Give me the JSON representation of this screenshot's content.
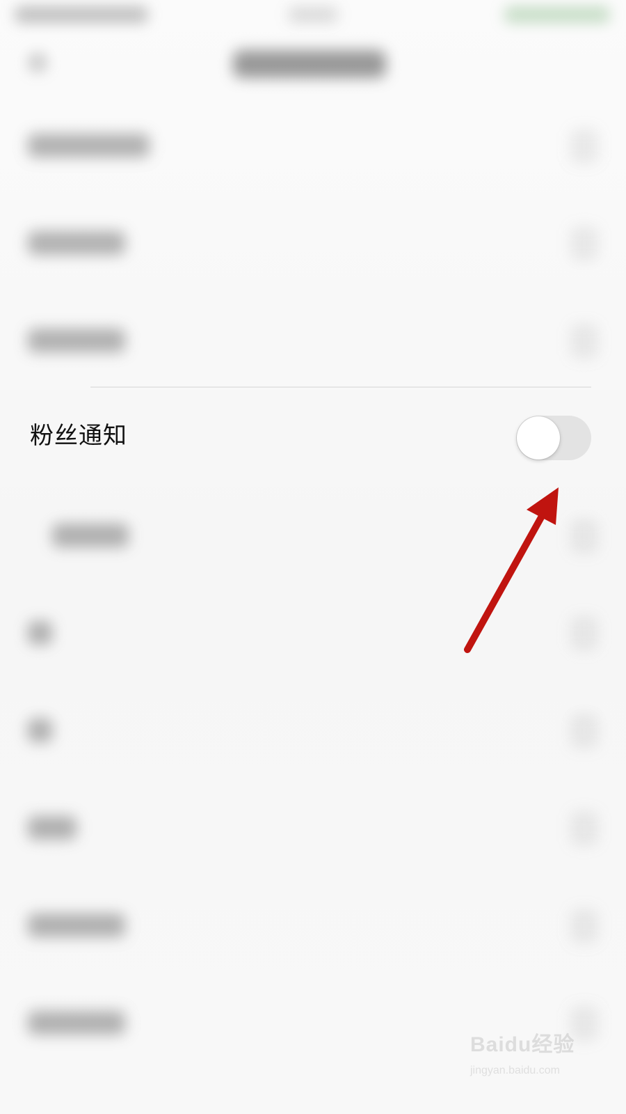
{
  "settings": {
    "fan_notification": {
      "label": "粉丝通知",
      "enabled": false
    }
  },
  "colors": {
    "background": "#f5f5f5",
    "focus_row_background": "#f7f7f7",
    "toggle_track_off": "#e3e3e3",
    "annotation_arrow": "#c0140f",
    "watermark": "#b8b8b8"
  },
  "icons": {
    "back": "back-icon",
    "chevron": "chevron-right-icon",
    "annotation": "arrow-annotation-icon",
    "watermark": "baidu-logo-icon"
  },
  "watermark": {
    "main_text": "Baidu经验",
    "sub_text": "jingyan.baidu.com"
  }
}
